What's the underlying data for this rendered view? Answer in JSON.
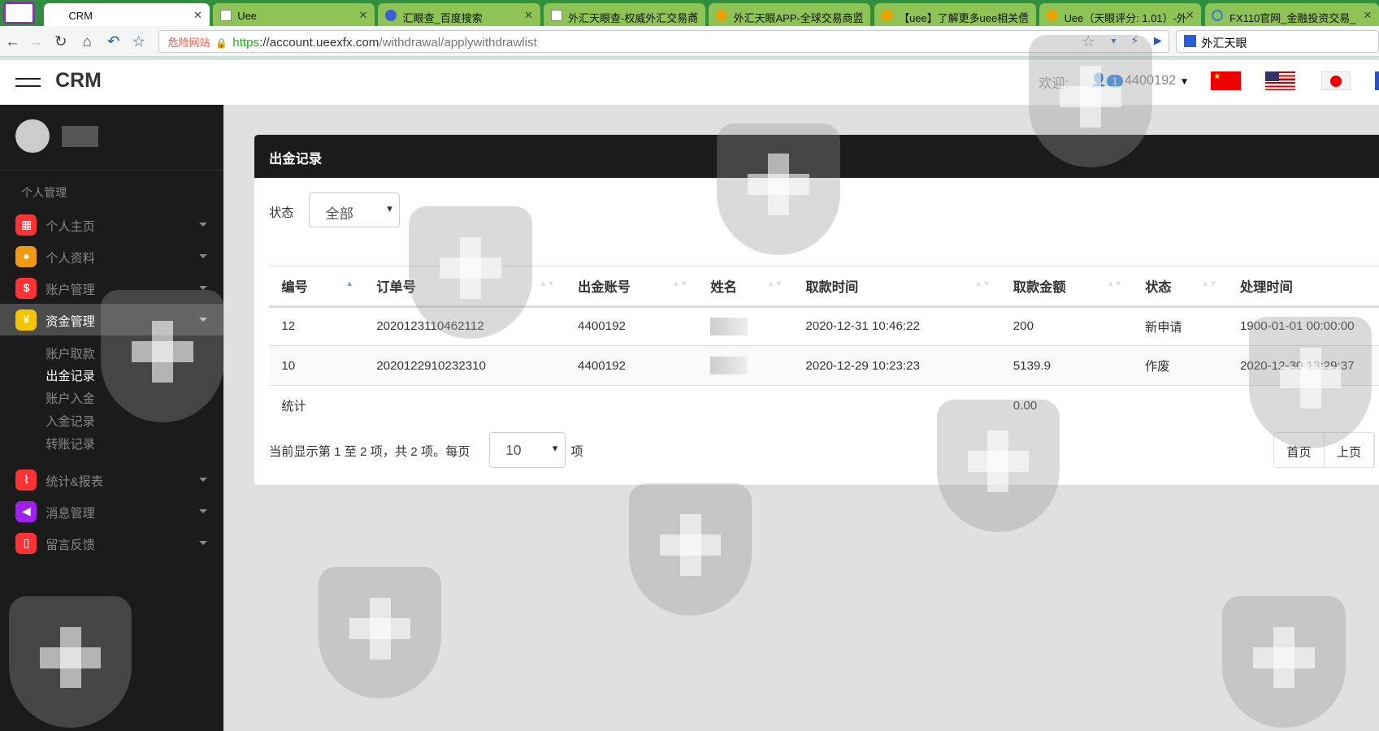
{
  "browser": {
    "tabs": [
      {
        "label": "CRM",
        "active": true
      },
      {
        "label": "Uee"
      },
      {
        "label": "汇眼查_百度搜索"
      },
      {
        "label": "外汇天眼查-权威外汇交易商"
      },
      {
        "label": "外汇天眼APP-全球交易商监"
      },
      {
        "label": "【uee】了解更多uee相关信"
      },
      {
        "label": "Uee（天眼评分: 1.01）-外"
      },
      {
        "label": "FX110官网_金融投资交易_"
      }
    ],
    "url_warning": "危险网站",
    "url_scheme": "https",
    "url_host": "://account.ueexfx.com",
    "url_path": "/withdrawal/applywithdrawlist",
    "search_engine": "外汇天眼"
  },
  "header": {
    "brand": "CRM",
    "welcome": "欢迎:",
    "badge": "1",
    "user": "4400192"
  },
  "sidebar": {
    "section": "个人管理",
    "items": [
      {
        "label": "个人主页",
        "color": "#f33"
      },
      {
        "label": "个人资料",
        "color": "#f39a12"
      },
      {
        "label": "账户管理",
        "color": "#f33"
      },
      {
        "label": "资金管理",
        "color": "#f5c400"
      },
      {
        "label": "统计&报表",
        "color": "#f33"
      },
      {
        "label": "消息管理",
        "color": "#a020f0"
      },
      {
        "label": "留言反馈",
        "color": "#f33"
      }
    ],
    "subitems": [
      "账户取款",
      "出金记录",
      "账户入金",
      "入金记录",
      "转账记录"
    ]
  },
  "panel": {
    "title": "出金记录",
    "filter_label": "状态",
    "filter_value": "全部",
    "columns": [
      "编号",
      "订单号",
      "出金账号",
      "姓名",
      "取款时间",
      "取款金额",
      "状态",
      "处理时间"
    ],
    "rows": [
      [
        "12",
        "2020123110462112",
        "4400192",
        "",
        "2020-12-31 10:46:22",
        "200",
        "新申请",
        "1900-01-01 00:00:00"
      ],
      [
        "10",
        "2020122910232310",
        "4400192",
        "",
        "2020-12-29 10:23:23",
        "5139.9",
        "作废",
        "2020-12-30 13:29:37"
      ]
    ],
    "total_label": "统计",
    "total_value": "0.00",
    "info": "当前显示第 1 至 2 项，共 2 项。每页",
    "page_size": "10",
    "info_suffix": "项",
    "pager": [
      "首页",
      "上页"
    ]
  }
}
